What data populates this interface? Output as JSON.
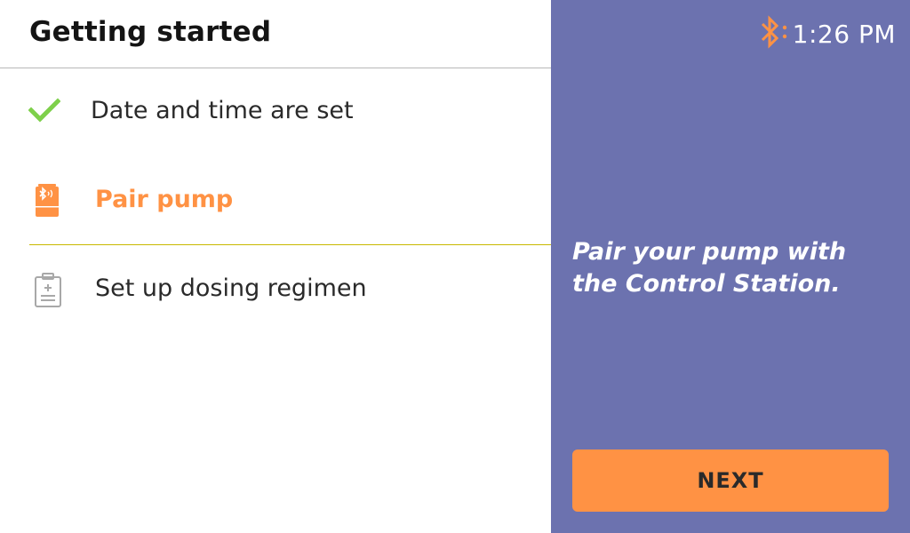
{
  "header": {
    "title": "Getting started"
  },
  "steps": [
    {
      "label": "Date and time are set",
      "icon": "checkmark-icon",
      "state": "complete"
    },
    {
      "label": "Pair pump",
      "icon": "pump-bluetooth-icon",
      "state": "active"
    },
    {
      "label": "Set up dosing regimen",
      "icon": "clipboard-icon",
      "state": "pending"
    }
  ],
  "status_bar": {
    "bluetooth_icon": "bluetooth-icon",
    "time": "1:26 PM"
  },
  "panel": {
    "message": "Pair your pump with the Control Station.",
    "next_label": "NEXT"
  },
  "colors": {
    "panel_bg": "#6C72AF",
    "accent_orange": "#FF9244",
    "check_green": "#7ED04B",
    "active_rule": "#C8B800",
    "pending_gray": "#A8A8A8"
  }
}
